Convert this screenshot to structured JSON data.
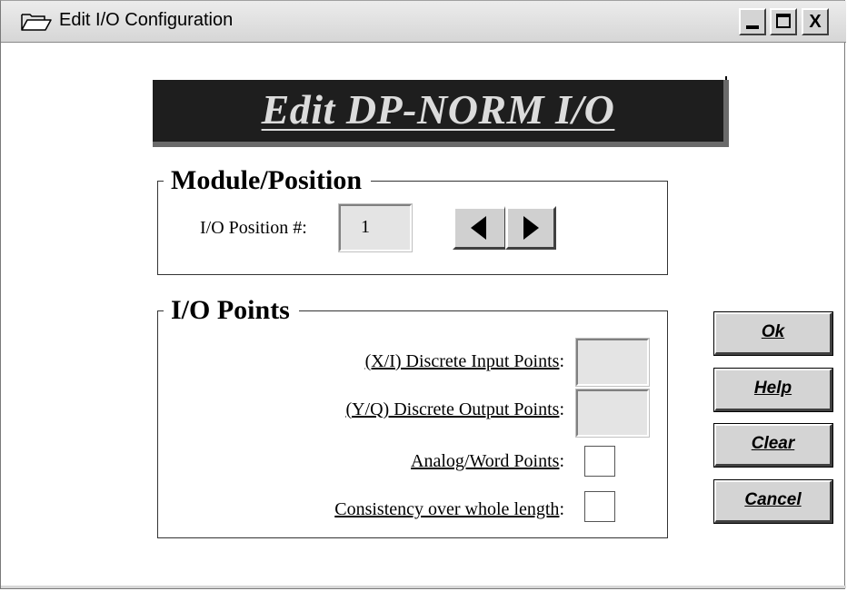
{
  "window": {
    "title": "Edit I/O Configuration",
    "icon": "folder-open-icon",
    "close_label": "X"
  },
  "banner": {
    "title": "Edit DP-NORM I/O"
  },
  "module_position": {
    "group_label": "Module/Position",
    "position_label": "I/O Position #:",
    "position_value": "1"
  },
  "io_points": {
    "group_label": "I/O Points",
    "discrete_input_label": "(X/I) Discrete Input Points",
    "discrete_output_label": "(Y/Q) Discrete Output Points",
    "analog_label": "Analog/Word Points",
    "consistency_label": "Consistency over whole length",
    "colon": ":"
  },
  "buttons": {
    "ok": "Ok",
    "help": "Help",
    "clear": "Clear",
    "cancel": "Cancel"
  }
}
